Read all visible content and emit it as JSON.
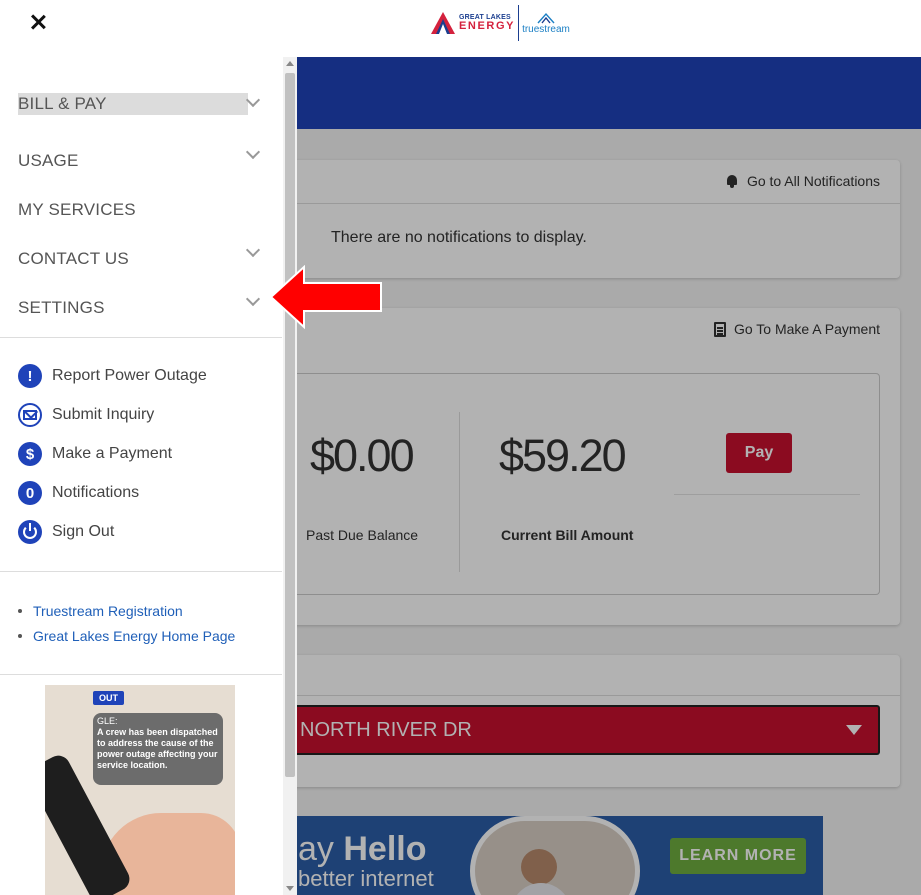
{
  "header": {
    "logo_gle_small": "GREAT LAKES",
    "logo_gle_big": "ENERGY",
    "logo_ts": "truestream"
  },
  "menu": {
    "items": [
      {
        "label": "BILL & PAY"
      },
      {
        "label": "USAGE"
      },
      {
        "label": "MY SERVICES"
      },
      {
        "label": "CONTACT US"
      },
      {
        "label": "SETTINGS"
      }
    ],
    "actions": [
      {
        "label": "Report Power Outage",
        "icon": "exclamation-icon"
      },
      {
        "label": "Submit Inquiry",
        "icon": "envelope-icon"
      },
      {
        "label": "Make a Payment",
        "icon": "dollar-icon"
      },
      {
        "label": "Notifications",
        "icon": "zero-badge-icon",
        "badge": "0"
      },
      {
        "label": "Sign Out",
        "icon": "power-icon"
      }
    ],
    "links": [
      {
        "label": "Truestream Registration"
      },
      {
        "label": "Great Lakes Energy Home Page"
      }
    ],
    "promo": {
      "badge": "OUT",
      "sender": "GLE:",
      "message": "A crew has been dispatched to address the cause of the power outage affecting your service location."
    }
  },
  "notifications": {
    "link": "Go to All Notifications",
    "empty": "There are no notifications to display."
  },
  "payment": {
    "link": "Go To Make A Payment",
    "past_due_amount": "$0.00",
    "past_due_label": "Past Due Balance",
    "current_amount": "$59.20",
    "current_label": "Current Bill Amount",
    "pay_button": "Pay"
  },
  "address": {
    "selected": "NORTH RIVER DR"
  },
  "ad": {
    "hello_prefix": "ay",
    "hello": "Hello",
    "subtitle": "better internet",
    "cta": "LEARN MORE"
  },
  "colors": {
    "brand_blue": "#1f43b9",
    "brand_red": "#c8102e",
    "link_blue": "#1f5fb8",
    "arrow_red": "#ff0000"
  }
}
